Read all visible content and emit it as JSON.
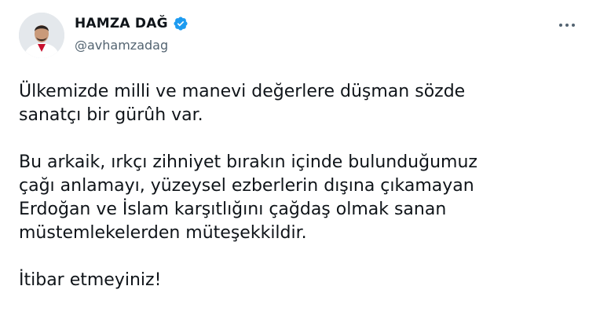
{
  "author": {
    "display_name": "HAMZA DAĞ",
    "handle": "@avhamzadag",
    "verified": true,
    "verified_color": "#1d9bf0"
  },
  "menu": {
    "more_icon": "more-horizontal-icon"
  },
  "tweet": {
    "paragraph_1": "Ülkemizde milli ve manevi değerlere düşman sözde\nsanatçı bir gürûh var.",
    "paragraph_2": "Bu arkaik, ırkçı zihniyet bırakın içinde bulunduğumuz\nçağı anlamayı, yüzeysel ezberlerin dışına çıkamayan\nErdoğan ve İslam karşıtlığını çağdaş olmak sanan\nmüstemlekelerden müteşekkildir.",
    "paragraph_3": "İtibar etmeyiniz!"
  }
}
